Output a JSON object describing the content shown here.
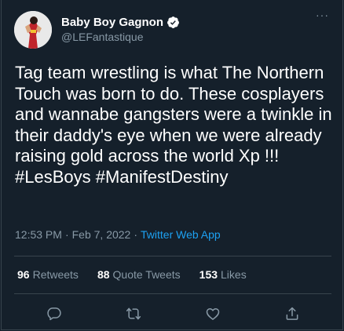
{
  "author": {
    "display_name": "Baby Boy Gagnon",
    "handle": "@LEFantastique",
    "verified": true
  },
  "tweet": {
    "text": "Tag team wrestling is what The Northern Touch was born to do. These cosplayers and wannabe gangsters were a twinkle in their daddy's eye when we were already raising gold across the world Xp !!! #LesBoys #ManifestDestiny",
    "time": "12:53 PM",
    "separator": "·",
    "date": "Feb 7, 2022",
    "source": "Twitter Web App"
  },
  "stats": {
    "retweets_count": "96",
    "retweets_label": "Retweets",
    "quotes_count": "88",
    "quotes_label": "Quote Tweets",
    "likes_count": "153",
    "likes_label": "Likes"
  },
  "more_label": "···",
  "icons": {
    "reply": "reply-icon",
    "retweet": "retweet-icon",
    "like": "heart-icon",
    "share": "share-icon",
    "verified": "verified-badge-icon"
  },
  "colors": {
    "background": "#15202b",
    "muted": "#8899a6",
    "accent": "#1da1f2",
    "divider": "#38444d"
  }
}
